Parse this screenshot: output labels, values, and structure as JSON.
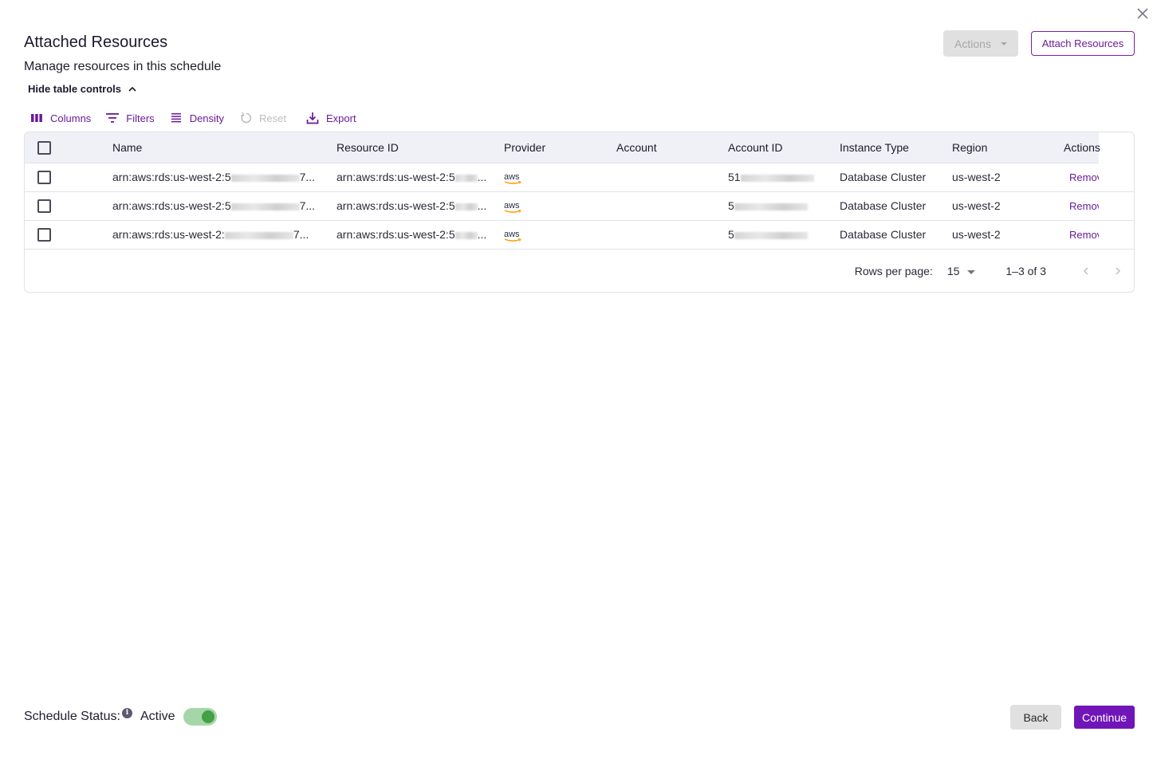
{
  "dialog": {
    "title": "Attached Resources",
    "subtitle": "Manage resources in this schedule",
    "close_icon": "close-icon"
  },
  "header_actions": {
    "actions_label": "Actions",
    "attach_label": "Attach Resources"
  },
  "table_controls": {
    "toggle_label": "Hide table controls",
    "tools": [
      {
        "label": "Columns",
        "icon": "columns-icon",
        "enabled": true
      },
      {
        "label": "Filters",
        "icon": "filter-icon",
        "enabled": true
      },
      {
        "label": "Density",
        "icon": "density-icon",
        "enabled": true
      },
      {
        "label": "Reset",
        "icon": "reset-icon",
        "enabled": false
      },
      {
        "label": "Export",
        "icon": "export-icon",
        "enabled": true
      }
    ]
  },
  "table": {
    "columns": [
      "Name",
      "Resource ID",
      "Provider",
      "Account",
      "Account ID",
      "Instance Type",
      "Region",
      "Actions"
    ],
    "rows": [
      {
        "name_prefix": "arn:aws:rds:us-west-2:5",
        "name_suffix": "7...",
        "resource_prefix": "arn:aws:rds:us-west-2:5",
        "resource_suffix": "...",
        "provider": "aws",
        "account": "",
        "account_id_prefix": "51",
        "instance_type": "Database Cluster",
        "region": "us-west-2",
        "action": "Remove"
      },
      {
        "name_prefix": "arn:aws:rds:us-west-2:5",
        "name_suffix": "7...",
        "resource_prefix": "arn:aws:rds:us-west-2:5",
        "resource_suffix": "...",
        "provider": "aws",
        "account": "",
        "account_id_prefix": "5",
        "instance_type": "Database Cluster",
        "region": "us-west-2",
        "action": "Remove"
      },
      {
        "name_prefix": "arn:aws:rds:us-west-2:",
        "name_suffix": "7...",
        "resource_prefix": "arn:aws:rds:us-west-2:5",
        "resource_suffix": "...",
        "provider": "aws",
        "account": "",
        "account_id_prefix": "5",
        "instance_type": "Database Cluster",
        "region": "us-west-2",
        "action": "Remove"
      }
    ]
  },
  "pagination": {
    "rows_per_page_label": "Rows per page:",
    "rows_per_page": "15",
    "range": "1–3 of 3"
  },
  "footer": {
    "status_label": "Schedule Status:",
    "info_glyph": "i",
    "status_value": "Active",
    "toggle_on": true,
    "back_label": "Back",
    "continue_label": "Continue"
  },
  "colors": {
    "accent": "#7016b8",
    "toggle_track": "#a5d6a7",
    "toggle_knob": "#43a047",
    "aws_orange": "#ff9900"
  }
}
